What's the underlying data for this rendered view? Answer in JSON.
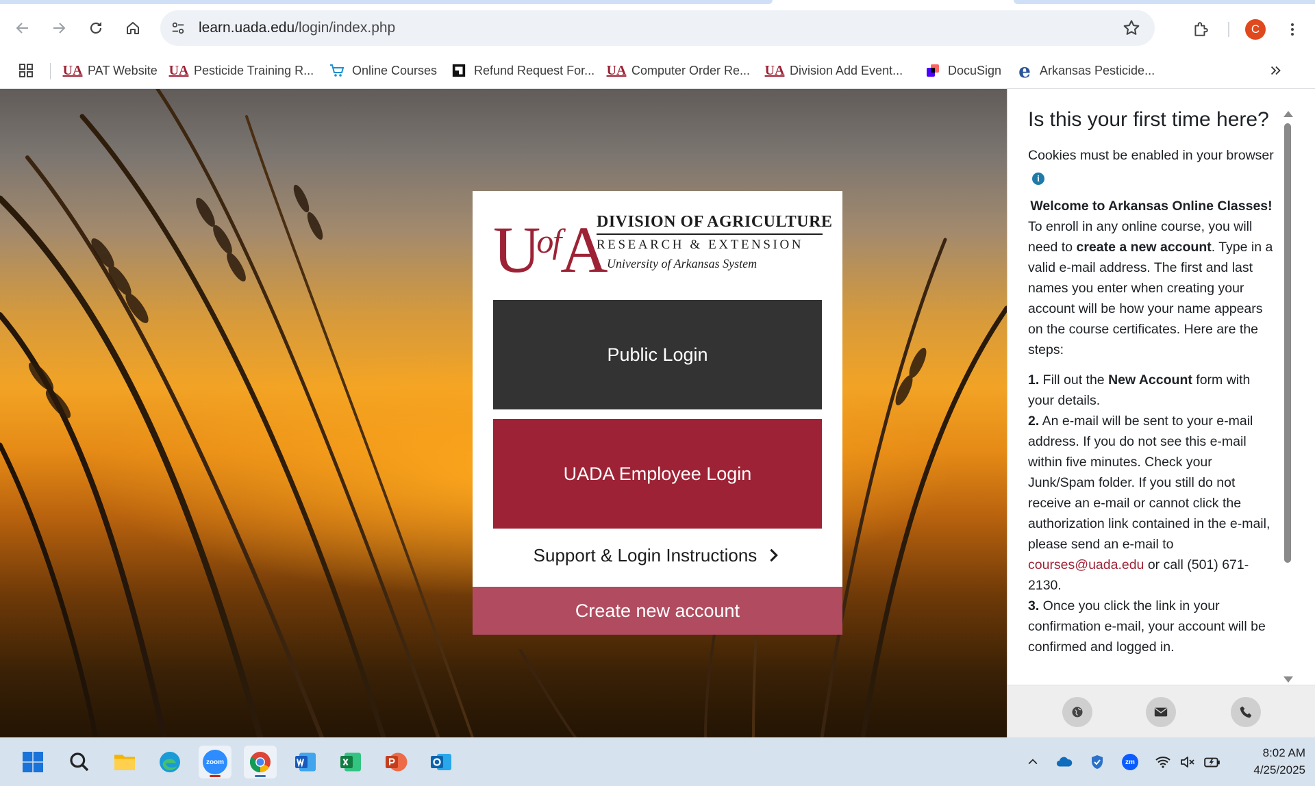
{
  "browser": {
    "url_host": "learn.uada.edu",
    "url_path": "/login/index.php",
    "profile_initial": "C",
    "bookmarks": [
      {
        "label": "PAT Website",
        "icon": "ua-logo-icon"
      },
      {
        "label": "Pesticide Training R...",
        "icon": "ua-logo-icon"
      },
      {
        "label": "Online Courses",
        "icon": "cart-icon"
      },
      {
        "label": "Refund Request For...",
        "icon": "form-icon"
      },
      {
        "label": "Computer Order Re...",
        "icon": "ua-logo-icon"
      },
      {
        "label": "Division Add Event...",
        "icon": "ua-logo-icon"
      },
      {
        "label": "DocuSign",
        "icon": "docusign-icon"
      },
      {
        "label": "Arkansas Pesticide...",
        "icon": "edge-e-icon"
      }
    ],
    "ua_glyph": "UA"
  },
  "logo": {
    "u": "U",
    "of": "of",
    "a": "A",
    "line1": "DIVISION OF AGRICULTURE",
    "line2": "RESEARCH & EXTENSION",
    "line3": "University of Arkansas System"
  },
  "login": {
    "public_login": "Public Login",
    "employee_login": "UADA Employee Login",
    "support": "Support & Login Instructions",
    "create_account": "Create new account"
  },
  "sidepanel": {
    "title": "Is this your first time here?",
    "cookies": "Cookies must be enabled in your browser",
    "info_glyph": "i",
    "welcome": "Welcome to Arkansas Online Classes!",
    "intro_pre": "To enroll in any online course, you will need to ",
    "intro_bold": "create a new account",
    "intro_post": ". Type in a valid e-mail address. The first and last names you enter when creating your account will be how your name appears on the course certificates. Here are the steps:",
    "step1_num": "1.",
    "step1_pre": " Fill out the ",
    "step1_bold": "New Account",
    "step1_post": " form with your details.",
    "step2_num": "2.",
    "step2_pre": " An e-mail will be sent to your e-mail address. If you do not see this e-mail within five minutes. Check your Junk/Spam folder. If you still do not receive an e-mail or cannot click the authorization link contained in the e-mail, please send an e-mail to ",
    "step2_email": "courses@uada.edu",
    "step2_post": " or call (501) 671-2130.",
    "step3_num": "3.",
    "step3_text": " Once you click the link in your confirmation e-mail, your account will be confirmed and logged in."
  },
  "taskbar": {
    "time": "8:02 AM",
    "date": "4/25/2025",
    "zoom_label": "zoom",
    "zm_label": "zm"
  },
  "colors": {
    "brand": "#9d2235",
    "create_account": "#b14c60",
    "public_login": "#333333"
  }
}
